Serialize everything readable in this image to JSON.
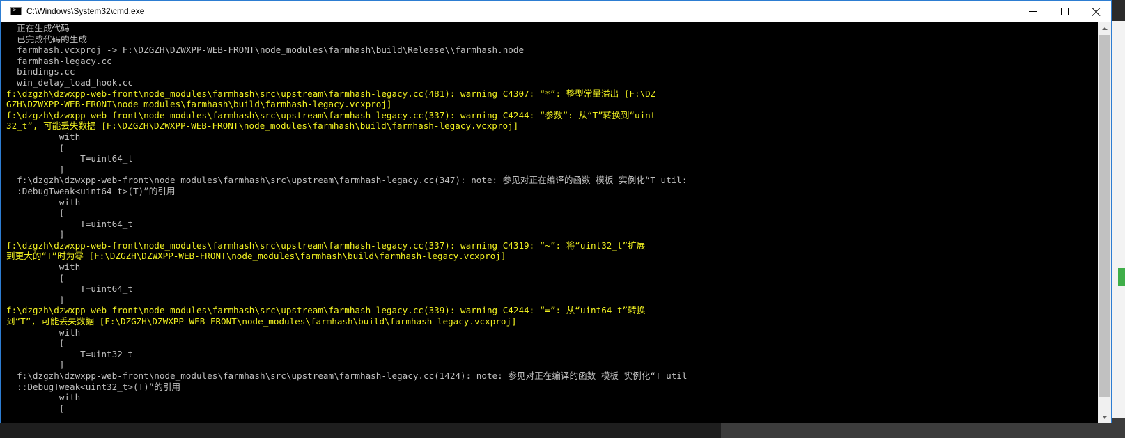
{
  "window": {
    "title": "C:\\Windows\\System32\\cmd.exe",
    "icon": "cmd-console-icon",
    "controls": {
      "minimize_icon": "minimize-icon",
      "maximize_icon": "maximize-icon",
      "close_icon": "close-icon"
    }
  },
  "colors": {
    "console_bg": "#000000",
    "normal_text": "#c0c0c0",
    "warning_text": "#f0f020",
    "window_border": "#2d7dd2"
  },
  "console": {
    "lines": [
      {
        "text": "  正在生成代码",
        "style": "gray"
      },
      {
        "text": "  已完成代码的生成",
        "style": "gray"
      },
      {
        "text": "  farmhash.vcxproj -> F:\\DZGZH\\DZWXPP-WEB-FRONT\\node_modules\\farmhash\\build\\Release\\\\farmhash.node",
        "style": "gray"
      },
      {
        "text": "  farmhash-legacy.cc",
        "style": "gray"
      },
      {
        "text": "  bindings.cc",
        "style": "gray"
      },
      {
        "text": "  win_delay_load_hook.cc",
        "style": "gray"
      },
      {
        "text": "f:\\dzgzh\\dzwxpp-web-front\\node_modules\\farmhash\\src\\upstream\\farmhash-legacy.cc(481): warning C4307: “*”: 整型常量溢出 [F:\\DZ",
        "style": "yellow"
      },
      {
        "text": "GZH\\DZWXPP-WEB-FRONT\\node_modules\\farmhash\\build\\farmhash-legacy.vcxproj]",
        "style": "yellow"
      },
      {
        "text": "f:\\dzgzh\\dzwxpp-web-front\\node_modules\\farmhash\\src\\upstream\\farmhash-legacy.cc(337): warning C4244: “参数”: 从“T”转换到“uint",
        "style": "yellow"
      },
      {
        "text": "32_t”, 可能丢失数据 [F:\\DZGZH\\DZWXPP-WEB-FRONT\\node_modules\\farmhash\\build\\farmhash-legacy.vcxproj]",
        "style": "yellow"
      },
      {
        "text": "          with",
        "style": "gray"
      },
      {
        "text": "          [",
        "style": "gray"
      },
      {
        "text": "              T=uint64_t",
        "style": "gray"
      },
      {
        "text": "          ]",
        "style": "gray"
      },
      {
        "text": "  f:\\dzgzh\\dzwxpp-web-front\\node_modules\\farmhash\\src\\upstream\\farmhash-legacy.cc(347): note: 参见对正在编译的函数 模板 实例化“T util:",
        "style": "gray"
      },
      {
        "text": "  :DebugTweak<uint64_t>(T)”的引用",
        "style": "gray"
      },
      {
        "text": "          with",
        "style": "gray"
      },
      {
        "text": "          [",
        "style": "gray"
      },
      {
        "text": "              T=uint64_t",
        "style": "gray"
      },
      {
        "text": "          ]",
        "style": "gray"
      },
      {
        "text": "f:\\dzgzh\\dzwxpp-web-front\\node_modules\\farmhash\\src\\upstream\\farmhash-legacy.cc(337): warning C4319: “~”: 将“uint32_t”扩展",
        "style": "yellow"
      },
      {
        "text": "到更大的“T”时为零 [F:\\DZGZH\\DZWXPP-WEB-FRONT\\node_modules\\farmhash\\build\\farmhash-legacy.vcxproj]",
        "style": "yellow"
      },
      {
        "text": "          with",
        "style": "gray"
      },
      {
        "text": "          [",
        "style": "gray"
      },
      {
        "text": "              T=uint64_t",
        "style": "gray"
      },
      {
        "text": "          ]",
        "style": "gray"
      },
      {
        "text": "f:\\dzgzh\\dzwxpp-web-front\\node_modules\\farmhash\\src\\upstream\\farmhash-legacy.cc(339): warning C4244: “=”: 从“uint64_t”转换",
        "style": "yellow"
      },
      {
        "text": "到“T”, 可能丢失数据 [F:\\DZGZH\\DZWXPP-WEB-FRONT\\node_modules\\farmhash\\build\\farmhash-legacy.vcxproj]",
        "style": "yellow"
      },
      {
        "text": "          with",
        "style": "gray"
      },
      {
        "text": "          [",
        "style": "gray"
      },
      {
        "text": "              T=uint32_t",
        "style": "gray"
      },
      {
        "text": "          ]",
        "style": "gray"
      },
      {
        "text": "  f:\\dzgzh\\dzwxpp-web-front\\node_modules\\farmhash\\src\\upstream\\farmhash-legacy.cc(1424): note: 参见对正在编译的函数 模板 实例化“T util",
        "style": "gray"
      },
      {
        "text": "  ::DebugTweak<uint32_t>(T)”的引用",
        "style": "gray"
      },
      {
        "text": "          with",
        "style": "gray"
      },
      {
        "text": "          [",
        "style": "gray"
      }
    ]
  }
}
